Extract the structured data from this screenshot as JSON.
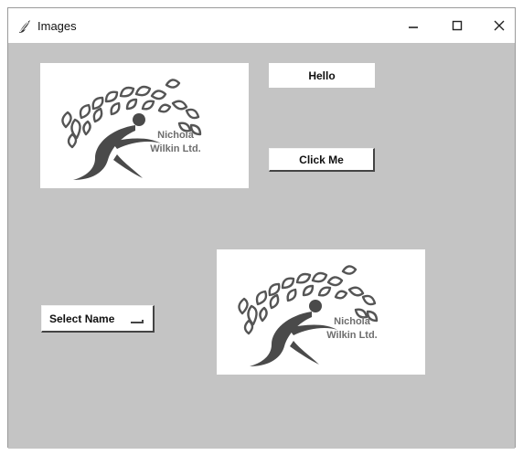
{
  "window": {
    "title": "Images",
    "app_icon": "feather-icon",
    "controls": {
      "minimize_icon": "minimize-icon",
      "maximize_icon": "maximize-icon",
      "close_icon": "close-icon"
    }
  },
  "client_background": "#c4c4c4",
  "logos": [
    {
      "line1": "Nichola",
      "line2": "Wilkin Ltd."
    },
    {
      "line1": "Nichola",
      "line2": "Wilkin Ltd."
    }
  ],
  "buttons": {
    "hello_label": "Hello",
    "click_label": "Click Me"
  },
  "option_menu": {
    "selected": "Select Name"
  }
}
